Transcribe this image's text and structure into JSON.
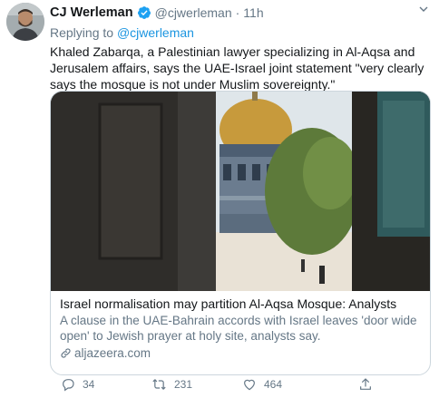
{
  "tweet": {
    "author_name": "CJ Werleman",
    "handle": "@cjwerleman",
    "separator": "·",
    "time": "11h",
    "replying_prefix": "Replying to",
    "replying_handle": "@cjwerleman",
    "text": "Khaled Zabarqa, a Palestinian lawyer specializing in Al-Aqsa and Jerusalem affairs, says the UAE-Israel joint statement \"very clearly says the mosque is not under Muslim sovereignty.\""
  },
  "card": {
    "title": "Israel normalisation may partition Al-Aqsa Mosque: Analysts",
    "description": "A clause in the UAE-Bahrain accords with Israel leaves 'door wide open' to Jewish prayer at holy site, analysts say.",
    "domain": "aljazeera.com"
  },
  "actions": {
    "reply_count": "34",
    "retweet_count": "231",
    "like_count": "464"
  },
  "colors": {
    "link": "#1b95e0",
    "secondary_text": "#657786",
    "verified": "#1da1f2",
    "border": "#ccd6dd"
  },
  "icons": [
    "verified-badge-icon",
    "caret-down-icon",
    "link-icon",
    "reply-icon",
    "retweet-icon",
    "like-icon",
    "share-icon"
  ]
}
